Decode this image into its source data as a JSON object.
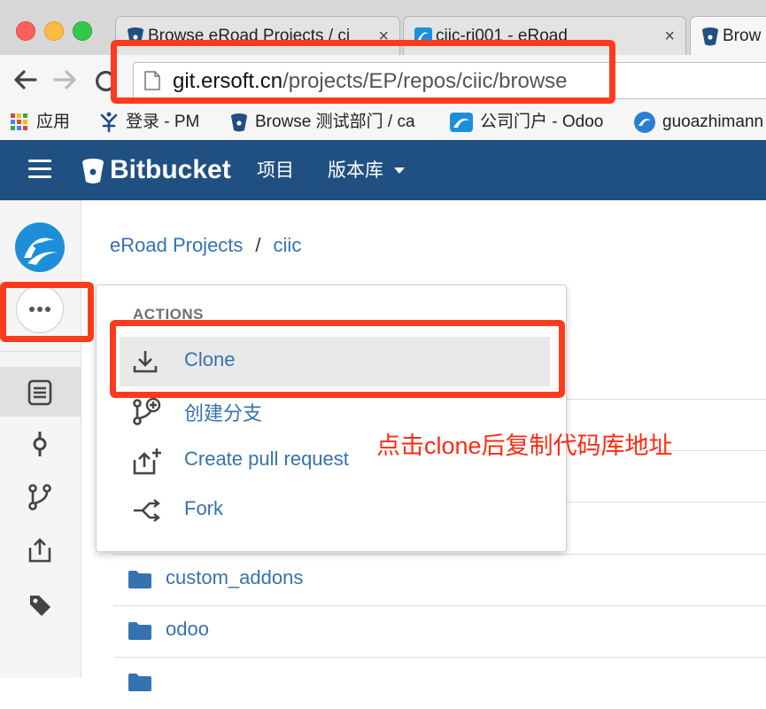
{
  "browser": {
    "tabs": [
      {
        "title": "Browse eRoad Projects / ci",
        "icon": "bitbucket-icon"
      },
      {
        "title": "ciic-ri001 - eRoad",
        "icon": "eroad-icon"
      },
      {
        "title": "Brow",
        "icon": "bitbucket-icon"
      }
    ],
    "tab_close_glyph": "×",
    "url_host": "git.ersoft.cn",
    "url_path": "/projects/EP/repos/ciic/browse",
    "bookmarks": [
      {
        "label": "应用",
        "icon": "apps-grid-icon"
      },
      {
        "label": "登录 - PM",
        "icon": "pm-icon"
      },
      {
        "label": "Browse 测试部门 / ca",
        "icon": "bitbucket-icon"
      },
      {
        "label": "公司门户 - Odoo",
        "icon": "eroad-icon"
      },
      {
        "label": "guoazhimann",
        "icon": "odoo-icon"
      }
    ]
  },
  "header": {
    "logo": "Bitbucket",
    "nav": [
      "项目",
      "版本库"
    ],
    "color": "#205081"
  },
  "breadcrumb": {
    "project": "eRoad Projects",
    "separator": "/",
    "repo": "ciic"
  },
  "actions_menu": {
    "heading": "ACTIONS",
    "items": [
      {
        "label": "Clone",
        "icon": "download-icon",
        "active": true
      },
      {
        "label": "创建分支",
        "icon": "branch-add-icon"
      },
      {
        "label": "Create pull request",
        "icon": "pull-request-icon"
      },
      {
        "label": "Fork",
        "icon": "fork-icon"
      }
    ]
  },
  "files": [
    {
      "name": "custom_addons",
      "icon": "folder-icon"
    },
    {
      "name": "odoo",
      "icon": "folder-icon"
    }
  ],
  "annotation": {
    "text": "点击clone后复制代码库地址",
    "color": "#ff3b1d"
  },
  "colors": {
    "link": "#3572b0",
    "sidebar": "#f5f5f5"
  }
}
